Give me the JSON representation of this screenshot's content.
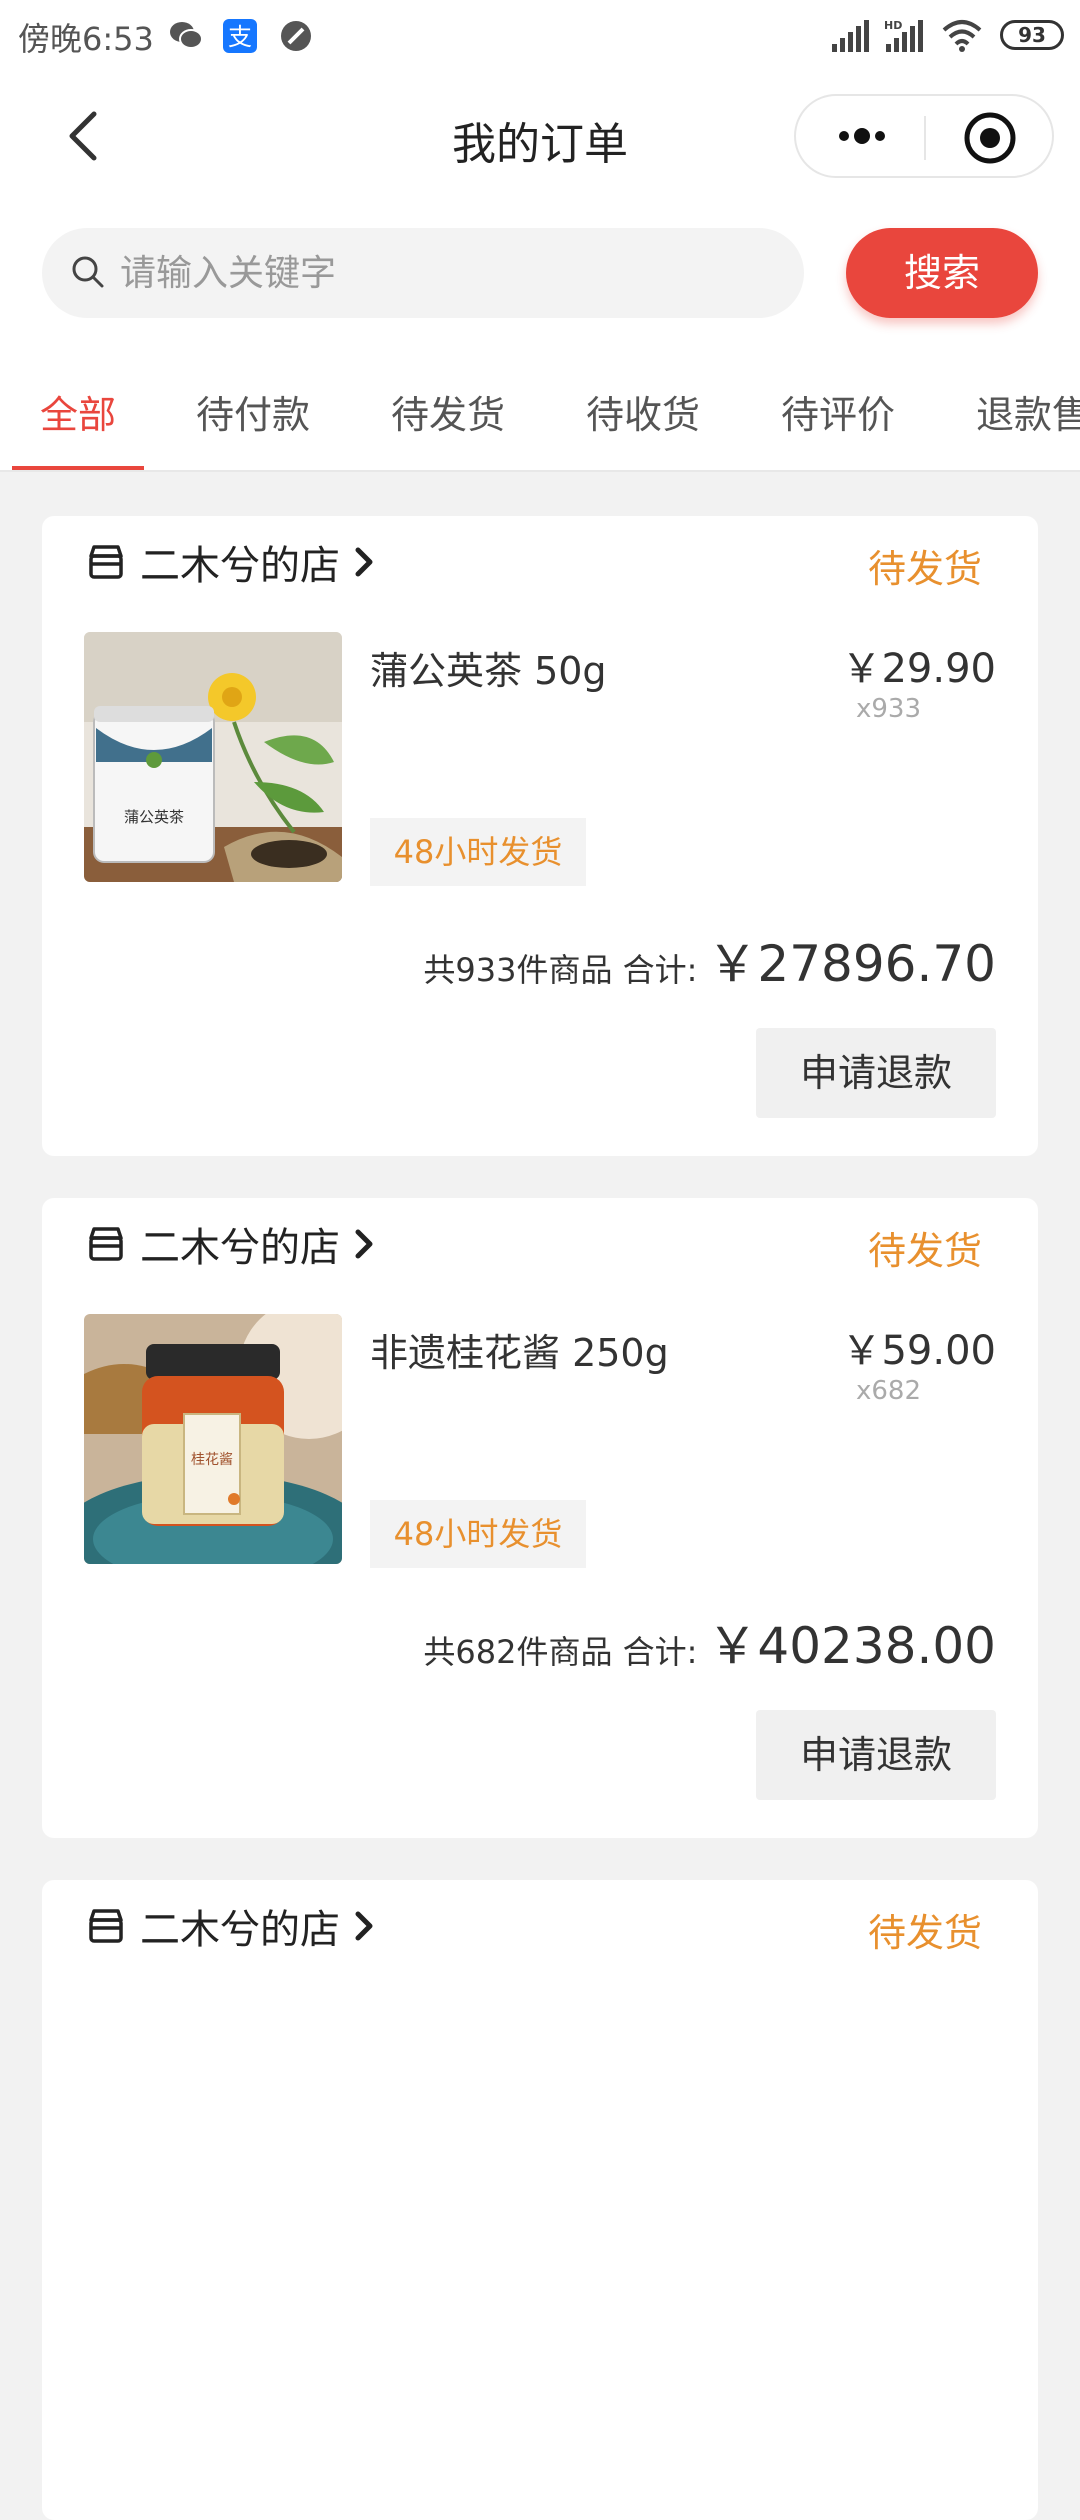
{
  "status_bar": {
    "time": "傍晚6:53",
    "battery": "93",
    "icons": [
      "wechat-icon",
      "alipay-icon",
      "blocked-icon",
      "signal-icon",
      "hd-signal-icon",
      "wifi-icon",
      "battery-icon"
    ]
  },
  "nav": {
    "title": "我的订单"
  },
  "search": {
    "placeholder": "请输入关键字",
    "value": "",
    "button_label": "搜索"
  },
  "tabs": [
    {
      "label": "全部",
      "active": true
    },
    {
      "label": "待付款",
      "active": false
    },
    {
      "label": "待发货",
      "active": false
    },
    {
      "label": "待收货",
      "active": false
    },
    {
      "label": "待评价",
      "active": false
    },
    {
      "label": "退款售后",
      "active": false
    }
  ],
  "orders": [
    {
      "shop_name": "二木兮的店",
      "status": "待发货",
      "product_name": "蒲公英茶 50g",
      "price": "￥29.90",
      "quantity": "x933",
      "ship_tag": "48小时发货",
      "summary_label": "共933件商品 合计:",
      "total": "￥27896.70",
      "action_label": "申请退款",
      "image_label": "蒲公英茶"
    },
    {
      "shop_name": "二木兮的店",
      "status": "待发货",
      "product_name": "非遗桂花酱 250g",
      "price": "￥59.00",
      "quantity": "x682",
      "ship_tag": "48小时发货",
      "summary_label": "共682件商品 合计:",
      "total": "￥40238.00",
      "action_label": "申请退款",
      "image_label": "桂花酱"
    },
    {
      "shop_name": "二木兮的店",
      "status": "待发货"
    }
  ],
  "colors": {
    "accent": "#e9463d",
    "status_orange": "#e8902e",
    "page_bg": "#f2f2f2"
  }
}
